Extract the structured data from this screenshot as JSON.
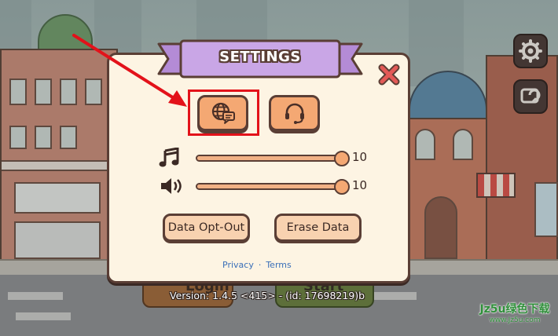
{
  "dialog": {
    "title": "SETTINGS",
    "close_icon": "close-x-icon",
    "language_button_icon": "globe-chat-icon",
    "support_button_icon": "headset-icon"
  },
  "audio": {
    "music": {
      "icon": "music-note-icon",
      "value": "10",
      "level": 1.0
    },
    "sound": {
      "icon": "speaker-icon",
      "value": "10",
      "level": 1.0
    }
  },
  "buttons": {
    "data_opt_out": "Data Opt-Out",
    "erase_data": "Erase Data"
  },
  "links": {
    "privacy": "Privacy",
    "separator": "·",
    "terms": "Terms"
  },
  "background": {
    "left_button_label": "Login",
    "right_button_label": "Start",
    "version_text": "Version: 1.4.5 <415> - (id: 17698219)b"
  },
  "side_buttons": {
    "settings_icon": "gear-icon",
    "switch_account_icon": "account-switch-icon"
  },
  "annotation": {
    "highlight_color": "#e3121a",
    "arrow_color": "#e3121a"
  },
  "watermark": {
    "title": "Jz5u绿色下载",
    "url": "www.Jz5u.com"
  },
  "colors": {
    "dialog_bg": "#fdf4e3",
    "ribbon": "#c9a6e6",
    "button_orange": "#f4a873",
    "outline": "#5a3e35",
    "close_red": "#e35a57"
  }
}
